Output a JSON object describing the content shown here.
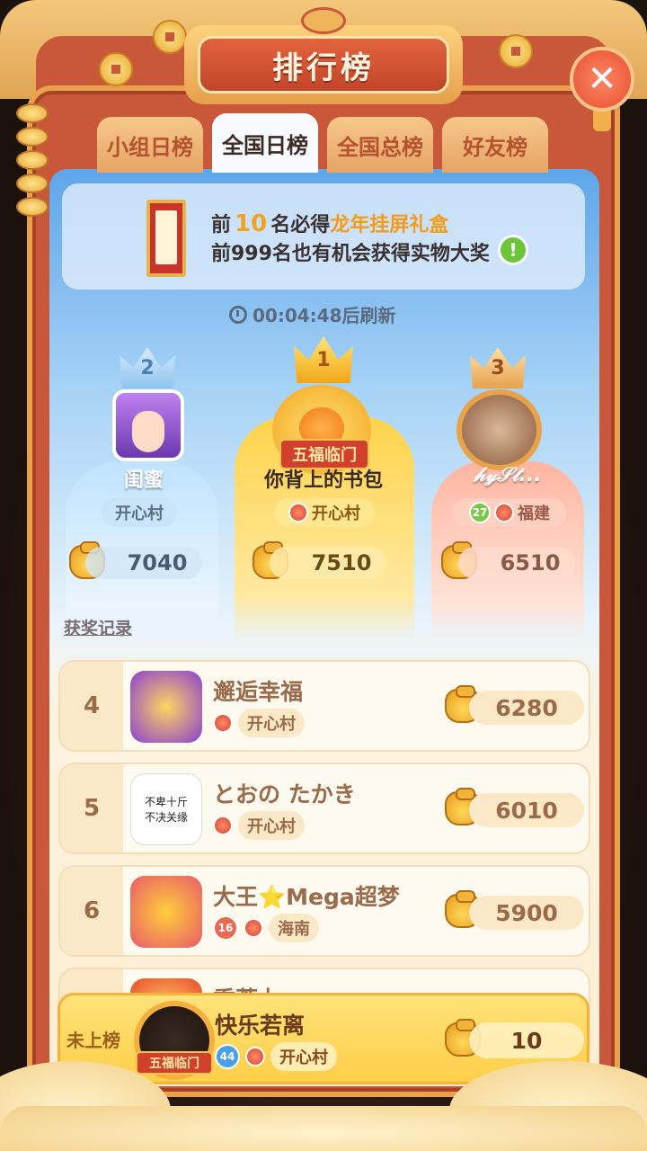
{
  "header": {
    "title": "排行榜",
    "close_symbol": "✕"
  },
  "tabs": [
    {
      "label": "小组日榜",
      "active": false
    },
    {
      "label": "全国日榜",
      "active": true
    },
    {
      "label": "全国总榜",
      "active": false
    },
    {
      "label": "好友榜",
      "active": false
    }
  ],
  "banner": {
    "line1_prefix": "前",
    "line1_number": "10",
    "line1_mid": "名必得",
    "line1_highlight": "龙年挂屏礼盒",
    "line2": "前999名也有机会获得实物大奖",
    "info_symbol": "!"
  },
  "timer": {
    "text": "00:04:48后刷新"
  },
  "podium": [
    {
      "rank": "2",
      "name": "闺蜜",
      "location": "开心村",
      "score": "7040"
    },
    {
      "rank": "1",
      "name": "你背上的书包",
      "location": "开心村",
      "score": "7510",
      "badge": "五福临门"
    },
    {
      "rank": "3",
      "name": "𝒽𝓎𝒮𝓉...",
      "level": "27",
      "location": "福建",
      "score": "6510"
    }
  ],
  "award_link": "获奖记录",
  "ranks": [
    {
      "rank": "4",
      "name": "邂逅幸福",
      "location": "开心村",
      "score": "6280"
    },
    {
      "rank": "5",
      "name": "とおの たかき",
      "location": "开心村",
      "score": "6010",
      "avatar_text": "不卑十斤 不决关缘"
    },
    {
      "rank": "6",
      "name": "大王⭐Mega超梦",
      "level": "16",
      "location": "海南",
      "score": "5900"
    },
    {
      "rank": "",
      "name": "重蓄力",
      "location": "",
      "score": ""
    }
  ],
  "self_row": {
    "rank": "未上榜",
    "name": "快乐若离",
    "level": "44",
    "location": "开心村",
    "score": "10",
    "badge": "五福临门"
  },
  "colors": {
    "frame": "#c9583a",
    "gold": "#f4a321",
    "panel_top": "#5ea6ea"
  }
}
